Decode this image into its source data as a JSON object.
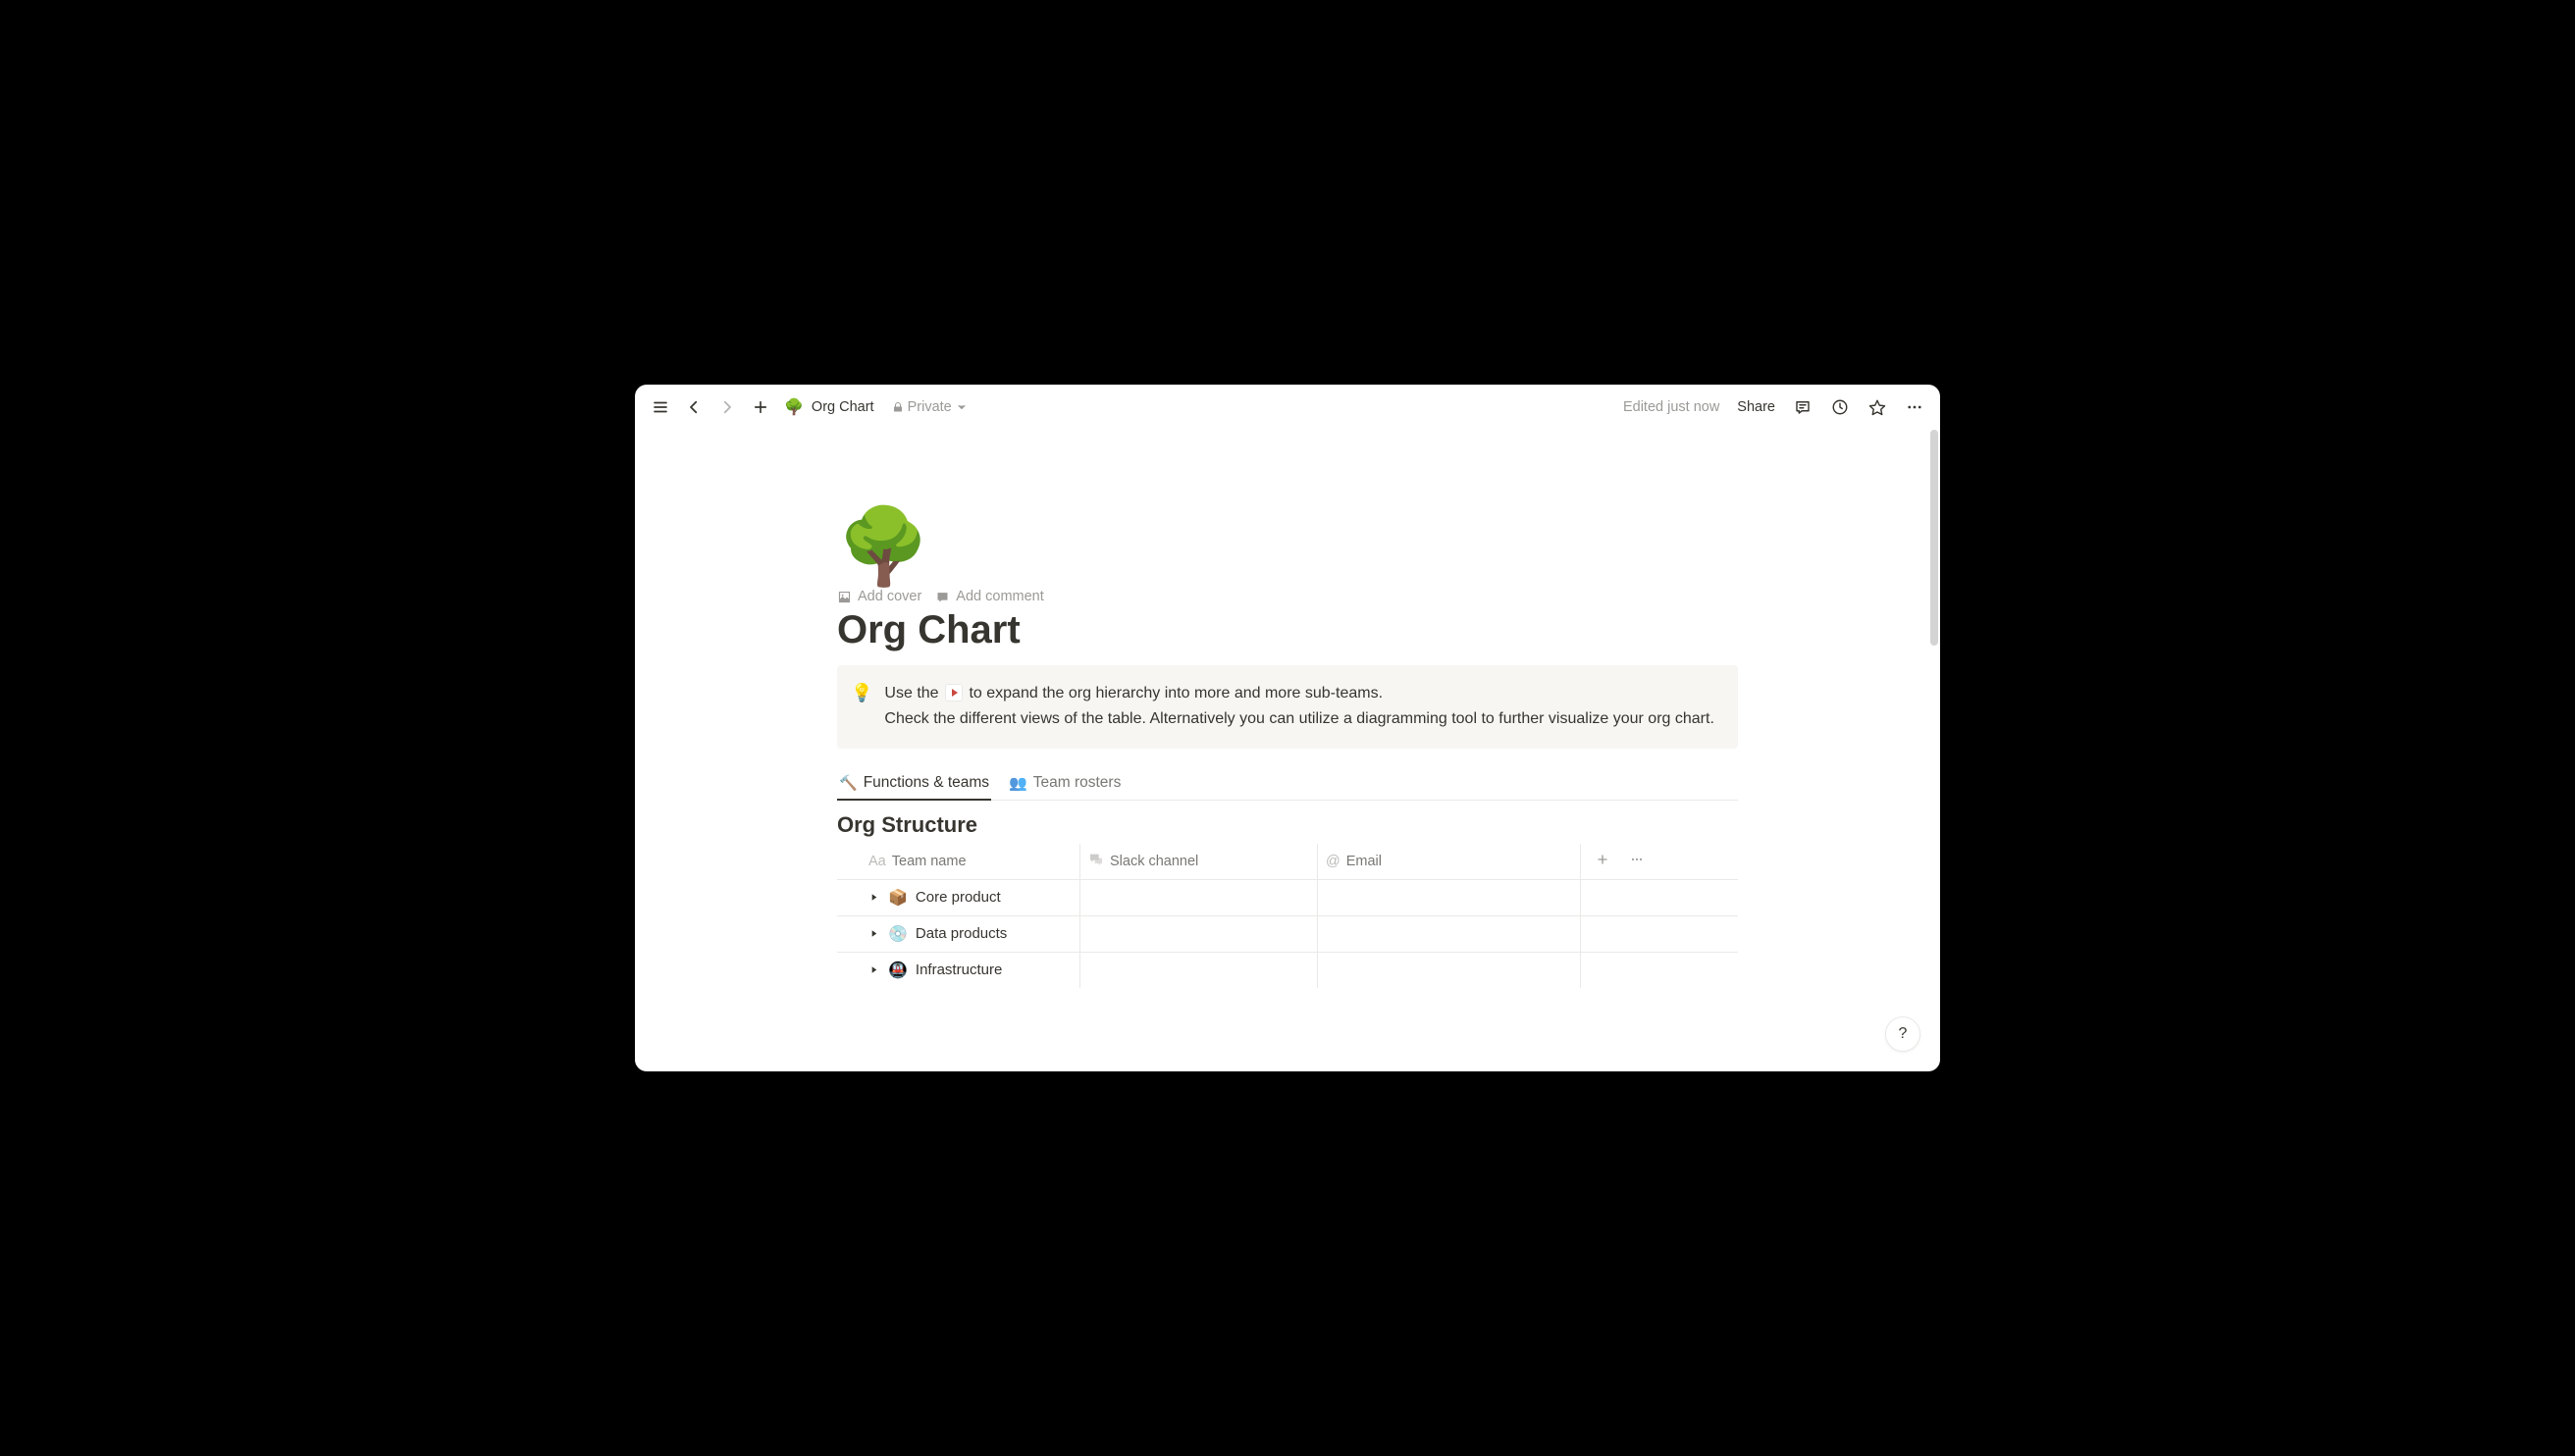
{
  "topbar": {
    "breadcrumb_emoji": "🌳",
    "breadcrumb_title": "Org Chart",
    "privacy_label": "Private",
    "edited_label": "Edited just now",
    "share_label": "Share"
  },
  "page": {
    "icon": "🌳",
    "add_cover_label": "Add cover",
    "add_comment_label": "Add comment",
    "title": "Org Chart"
  },
  "callout": {
    "icon": "💡",
    "text_before": "Use the ",
    "text_after": " to expand the org hierarchy into more and more sub-teams.",
    "text_line2": "Check the different views of the table. Alternatively you can utilize a diagramming tool to further visualize your org chart."
  },
  "tabs": [
    {
      "icon": "🔨",
      "label": "Functions & teams",
      "active": true
    },
    {
      "icon": "👥",
      "label": "Team rosters",
      "active": false
    }
  ],
  "section_title": "Org Structure",
  "table": {
    "columns": {
      "name": "Team name",
      "slack": "Slack channel",
      "email": "Email"
    },
    "rows": [
      {
        "emoji": "📦",
        "name": "Core product",
        "slack": "",
        "email": ""
      },
      {
        "emoji": "💿",
        "name": "Data products",
        "slack": "",
        "email": ""
      },
      {
        "emoji": "🚇",
        "name": "Infrastructure",
        "slack": "",
        "email": ""
      }
    ]
  },
  "help_label": "?"
}
